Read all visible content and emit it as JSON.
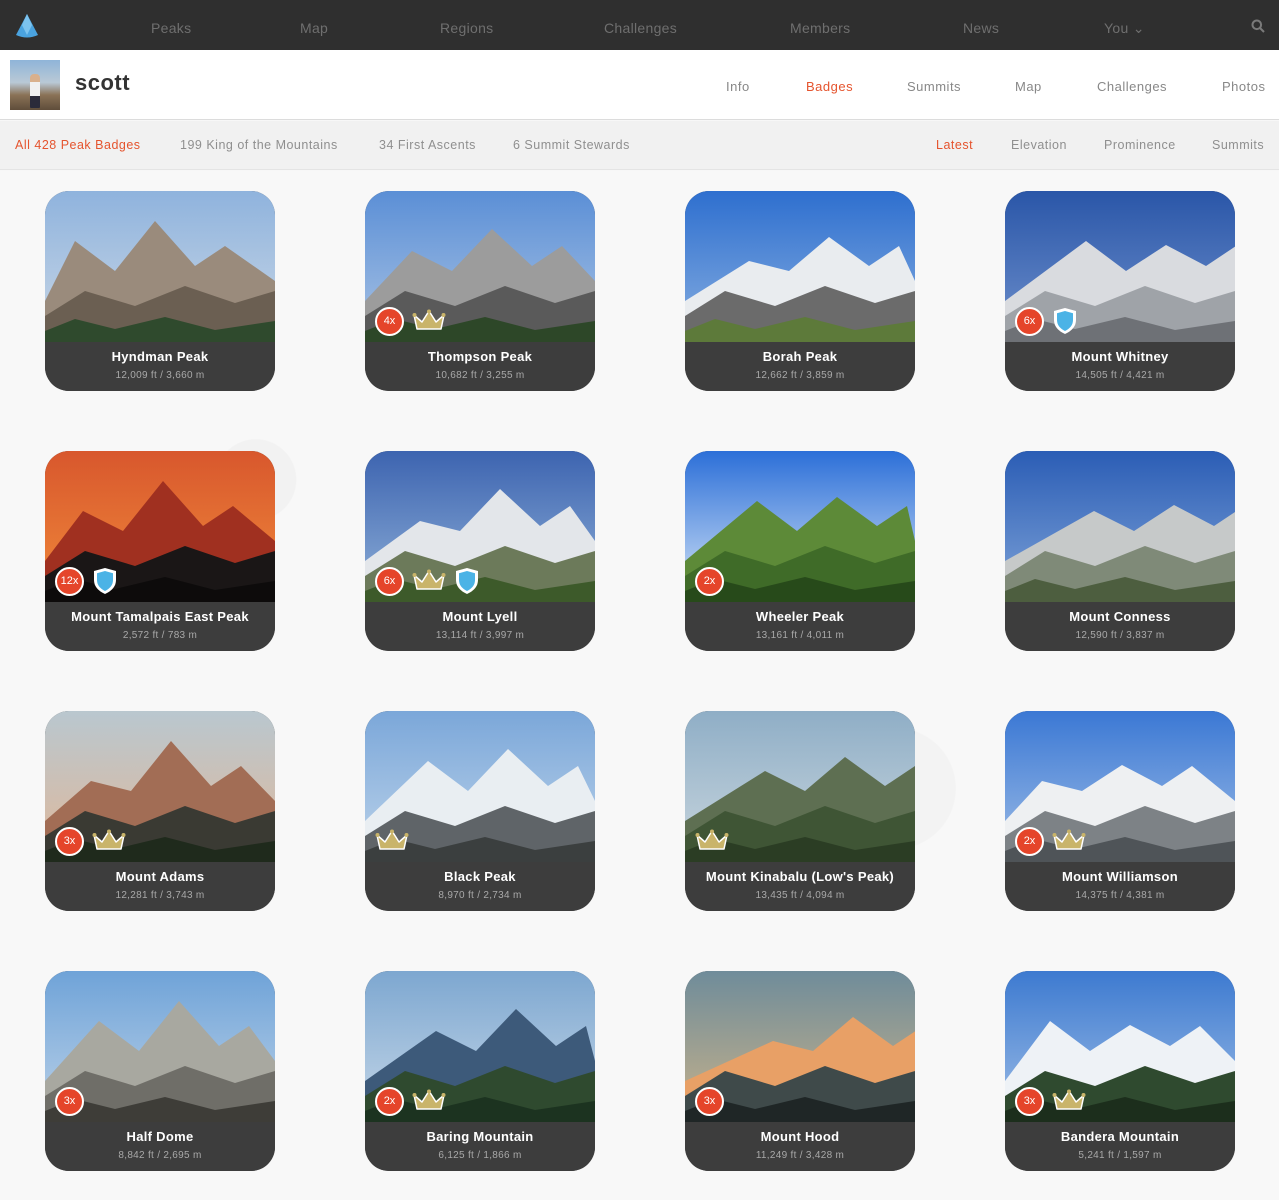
{
  "topnav": {
    "items": [
      "Peaks",
      "Map",
      "Regions",
      "Challenges",
      "Members",
      "News",
      "You ⌄"
    ]
  },
  "profile": {
    "username": "scott",
    "tabs": [
      "Info",
      "Badges",
      "Summits",
      "Map",
      "Challenges",
      "Photos"
    ],
    "active_tab": "Badges"
  },
  "filters": {
    "left": [
      "All 428 Peak Badges",
      "199 King of the Mountains",
      "34 First Ascents",
      "6 Summit Stewards"
    ],
    "sort": [
      "Latest",
      "Elevation",
      "Prominence",
      "Summits"
    ],
    "active_left": "All 428 Peak Badges",
    "active_sort": "Latest"
  },
  "colors": {
    "accent": "#e5542e",
    "nav_bg": "#2f2f2f",
    "card_caption": "#3d3d3d",
    "crown": "#c9b46a",
    "shield": "#4bb3e6"
  },
  "cards": [
    {
      "name": "Hyndman Peak",
      "elev": "12,009 ft / 3,660 m",
      "count": "",
      "crown": false,
      "shield": false
    },
    {
      "name": "Thompson Peak",
      "elev": "10,682 ft / 3,255 m",
      "count": "4x",
      "crown": true,
      "shield": false
    },
    {
      "name": "Borah Peak",
      "elev": "12,662 ft / 3,859 m",
      "count": "",
      "crown": false,
      "shield": false
    },
    {
      "name": "Mount Whitney",
      "elev": "14,505 ft / 4,421 m",
      "count": "6x",
      "crown": false,
      "shield": true
    },
    {
      "name": "Mount Tamalpais East Peak",
      "elev": "2,572 ft / 783 m",
      "count": "12x",
      "crown": false,
      "shield": true
    },
    {
      "name": "Mount Lyell",
      "elev": "13,114 ft / 3,997 m",
      "count": "6x",
      "crown": true,
      "shield": true
    },
    {
      "name": "Wheeler Peak",
      "elev": "13,161 ft / 4,011 m",
      "count": "2x",
      "crown": false,
      "shield": false
    },
    {
      "name": "Mount Conness",
      "elev": "12,590 ft / 3,837 m",
      "count": "",
      "crown": false,
      "shield": false
    },
    {
      "name": "Mount Adams",
      "elev": "12,281 ft / 3,743 m",
      "count": "3x",
      "crown": true,
      "shield": false
    },
    {
      "name": "Black Peak",
      "elev": "8,970 ft / 2,734 m",
      "count": "",
      "crown": true,
      "shield": false
    },
    {
      "name": "Mount Kinabalu (Low's Peak)",
      "elev": "13,435 ft / 4,094 m",
      "count": "",
      "crown": true,
      "shield": false
    },
    {
      "name": "Mount Williamson",
      "elev": "14,375 ft / 4,381 m",
      "count": "2x",
      "crown": true,
      "shield": false
    },
    {
      "name": "Half Dome",
      "elev": "8,842 ft / 2,695 m",
      "count": "3x",
      "crown": false,
      "shield": false
    },
    {
      "name": "Baring Mountain",
      "elev": "6,125 ft / 1,866 m",
      "count": "2x",
      "crown": true,
      "shield": false
    },
    {
      "name": "Mount Hood",
      "elev": "11,249 ft / 3,428 m",
      "count": "3x",
      "crown": false,
      "shield": false
    },
    {
      "name": "Bandera Mountain",
      "elev": "5,241 ft / 1,597 m",
      "count": "3x",
      "crown": true,
      "shield": false
    }
  ]
}
